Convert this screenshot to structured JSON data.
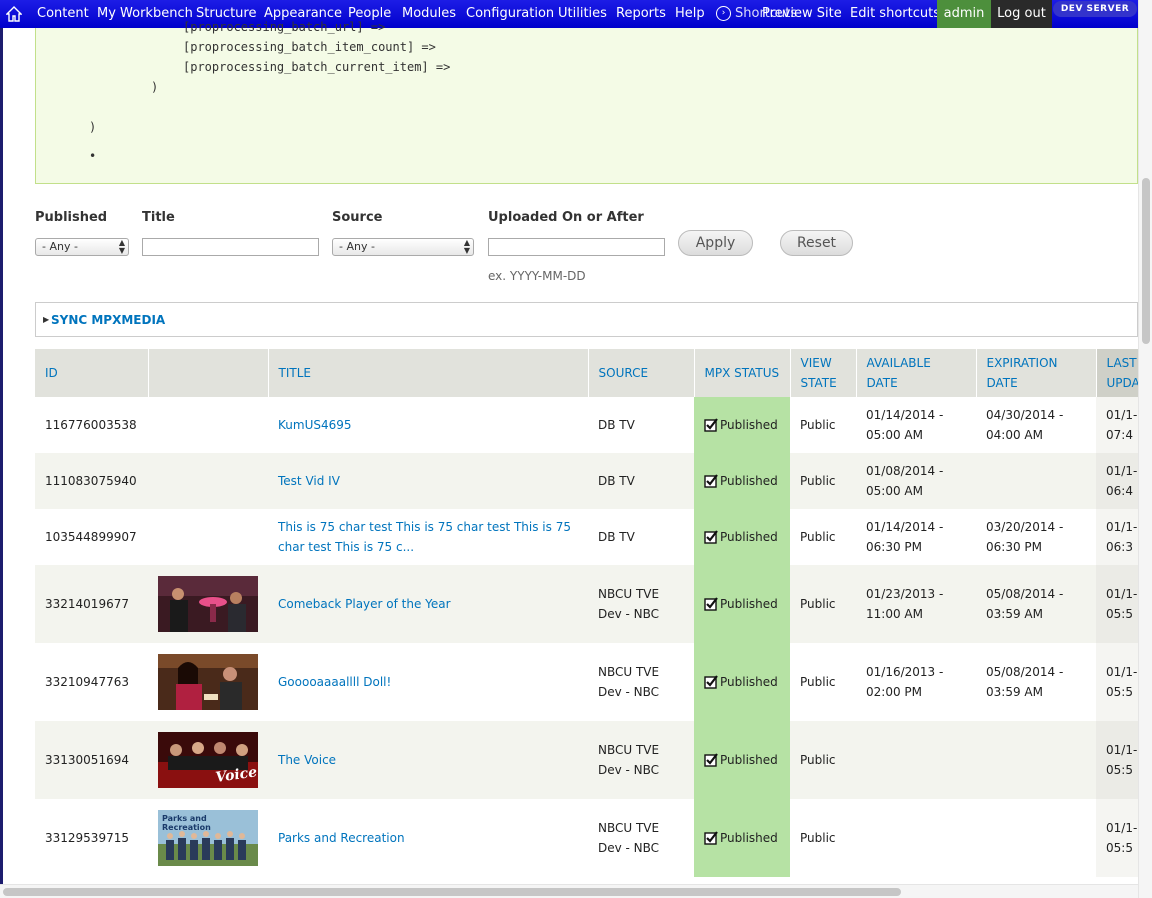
{
  "toolbar": {
    "items": [
      "Content",
      "My Workbench",
      "Structure",
      "Appearance",
      "People",
      "Modules",
      "Configuration",
      "Utilities",
      "Reports",
      "Help"
    ],
    "shortcuts_label": "Shortcuts",
    "preview_site": "Preview Site",
    "edit_shortcuts": "Edit shortcuts",
    "user": "admin",
    "logout": "Log out",
    "env_badge": "DEV SERVER",
    "colors": {
      "bar": "#0000cc",
      "user_bg": "#4d8f3c",
      "logout_bg": "#2a2a2a"
    }
  },
  "debug": {
    "lines": [
      "[proprocessing_batch_url] =>",
      "[proprocessing_batch_item_count] =>",
      "[proprocessing_batch_current_item] =>",
      ")",
      ")",
      "•"
    ]
  },
  "filters": {
    "published": {
      "label": "Published",
      "value": "- Any -"
    },
    "title": {
      "label": "Title",
      "value": ""
    },
    "source": {
      "label": "Source",
      "value": "- Any -"
    },
    "uploaded": {
      "label": "Uploaded On or After",
      "value": "",
      "hint": "ex. YYYY-MM-DD"
    },
    "apply_label": "Apply",
    "reset_label": "Reset"
  },
  "sync": {
    "title": "SYNC MPXMEDIA"
  },
  "table": {
    "headers": [
      "ID",
      "",
      "TITLE",
      "SOURCE",
      "MPX STATUS",
      "VIEW STATE",
      "AVAILABLE DATE",
      "EXPIRATION DATE",
      "LAST UPDA"
    ],
    "rows": [
      {
        "id": "116776003538",
        "thumb": "",
        "title": "KumUS4695",
        "source": "DB TV",
        "status": "Published",
        "view": "Public",
        "available": "01/14/2014 - 05:00 AM",
        "expiration": "04/30/2014 - 04:00 AM",
        "last": "01/1- 07:4"
      },
      {
        "id": "111083075940",
        "thumb": "",
        "title": "Test Vid IV",
        "source": "DB TV",
        "status": "Published",
        "view": "Public",
        "available": "01/08/2014 - 05:00 AM",
        "expiration": "",
        "last": "01/1- 06:4"
      },
      {
        "id": "103544899907",
        "thumb": "",
        "title": "This is 75 char test This is 75 char test This is 75 char test This is 75 c...",
        "source": "DB TV",
        "status": "Published",
        "view": "Public",
        "available": "01/14/2014 - 06:30 PM",
        "expiration": "03/20/2014 - 06:30 PM",
        "last": "01/1- 06:3"
      },
      {
        "id": "33214019677",
        "thumb": "bar-scene",
        "title": "Comeback Player of the Year",
        "source": "NBCU TVE Dev - NBC",
        "status": "Published",
        "view": "Public",
        "available": "01/23/2013 - 11:00 AM",
        "expiration": "05/08/2014 - 03:59 AM",
        "last": "01/1- 05:5"
      },
      {
        "id": "33210947763",
        "thumb": "doll-scene",
        "title": "Gooooaaaallll Doll!",
        "source": "NBCU TVE Dev - NBC",
        "status": "Published",
        "view": "Public",
        "available": "01/16/2013 - 02:00 PM",
        "expiration": "05/08/2014 - 03:59 AM",
        "last": "01/1- 05:5"
      },
      {
        "id": "33130051694",
        "thumb": "voice-logo",
        "title": "The Voice",
        "source": "NBCU TVE Dev - NBC",
        "status": "Published",
        "view": "Public",
        "available": "",
        "expiration": "",
        "last": "01/1- 05:5"
      },
      {
        "id": "33129539715",
        "thumb": "parks-cast",
        "title": "Parks and Recreation",
        "source": "NBCU TVE Dev - NBC",
        "status": "Published",
        "view": "Public",
        "available": "",
        "expiration": "",
        "last": "01/1- 05:5"
      }
    ]
  }
}
